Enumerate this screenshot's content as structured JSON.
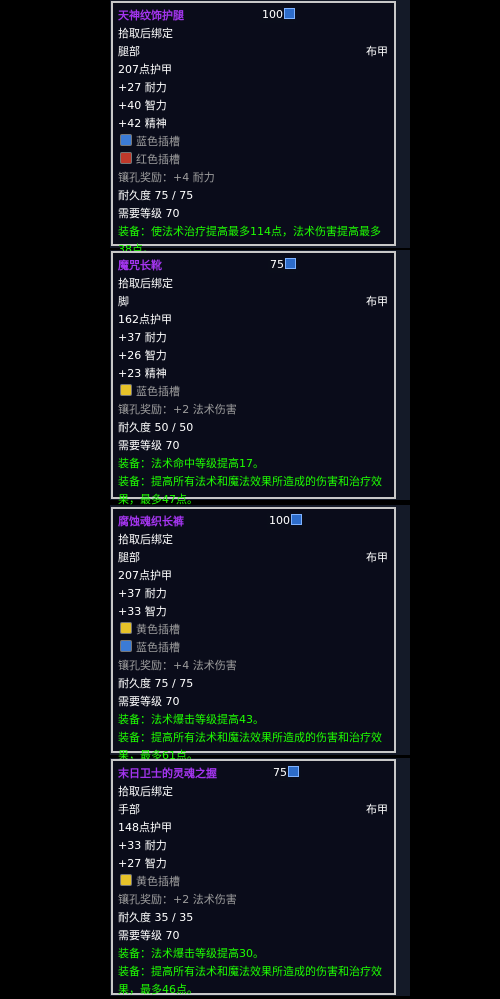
{
  "tooltips": [
    {
      "name": "天神纹饰护腿",
      "count": "100",
      "bind": "拾取后绑定",
      "slot": "腿部",
      "type": "布甲",
      "armor": "207点护甲",
      "stats": [
        "+27 耐力",
        "+40 智力",
        "+42 精神"
      ],
      "sockets": [
        {
          "label": "蓝色插槽",
          "color": "blue"
        },
        {
          "label": "红色插槽",
          "color": "red"
        }
      ],
      "socket_bonus": "镶孔奖励：+4 耐力",
      "durability": "耐久度 75 / 75",
      "req_level": "需要等级 70",
      "effects": [
        "装备：使法术治疗提高最多114点，法术伤害提高最多38点。"
      ]
    },
    {
      "name": "魔咒长靴",
      "count": "75",
      "bind": "拾取后绑定",
      "slot": "脚",
      "type": "布甲",
      "armor": "162点护甲",
      "stats": [
        "+37 耐力",
        "+26 智力",
        "+23 精神"
      ],
      "sockets": [
        {
          "label": "蓝色插槽",
          "color": "yellow"
        }
      ],
      "socket_bonus": "镶孔奖励：+2 法术伤害",
      "durability": "耐久度 50 / 50",
      "req_level": "需要等级 70",
      "effects": [
        "装备：法术命中等级提高17。",
        "装备：提高所有法术和魔法效果所造成的伤害和治疗效果，最多47点。"
      ]
    },
    {
      "name": "腐蚀魂织长裤",
      "count": "100",
      "bind": "拾取后绑定",
      "slot": "腿部",
      "type": "布甲",
      "armor": "207点护甲",
      "stats": [
        "+37 耐力",
        "+33 智力"
      ],
      "sockets": [
        {
          "label": "黄色插槽",
          "color": "yellow"
        },
        {
          "label": "蓝色插槽",
          "color": "blue"
        }
      ],
      "socket_bonus": "镶孔奖励：+4 法术伤害",
      "durability": "耐久度 75 / 75",
      "req_level": "需要等级 70",
      "effects": [
        "装备：法术爆击等级提高43。",
        "装备：提高所有法术和魔法效果所造成的伤害和治疗效果，最多61点。"
      ]
    },
    {
      "name": "末日卫士的灵魂之握",
      "count": "75",
      "bind": "拾取后绑定",
      "slot": "手部",
      "type": "布甲",
      "armor": "148点护甲",
      "stats": [
        "+33 耐力",
        "+27 智力"
      ],
      "sockets": [
        {
          "label": "黄色插槽",
          "color": "yellow"
        }
      ],
      "socket_bonus": "镶孔奖励：+2 法术伤害",
      "durability": "耐久度 35 / 35",
      "req_level": "需要等级 70",
      "effects": [
        "装备：法术爆击等级提高30。",
        "装备：提高所有法术和魔法效果所造成的伤害和治疗效果，最多46点。"
      ]
    }
  ]
}
